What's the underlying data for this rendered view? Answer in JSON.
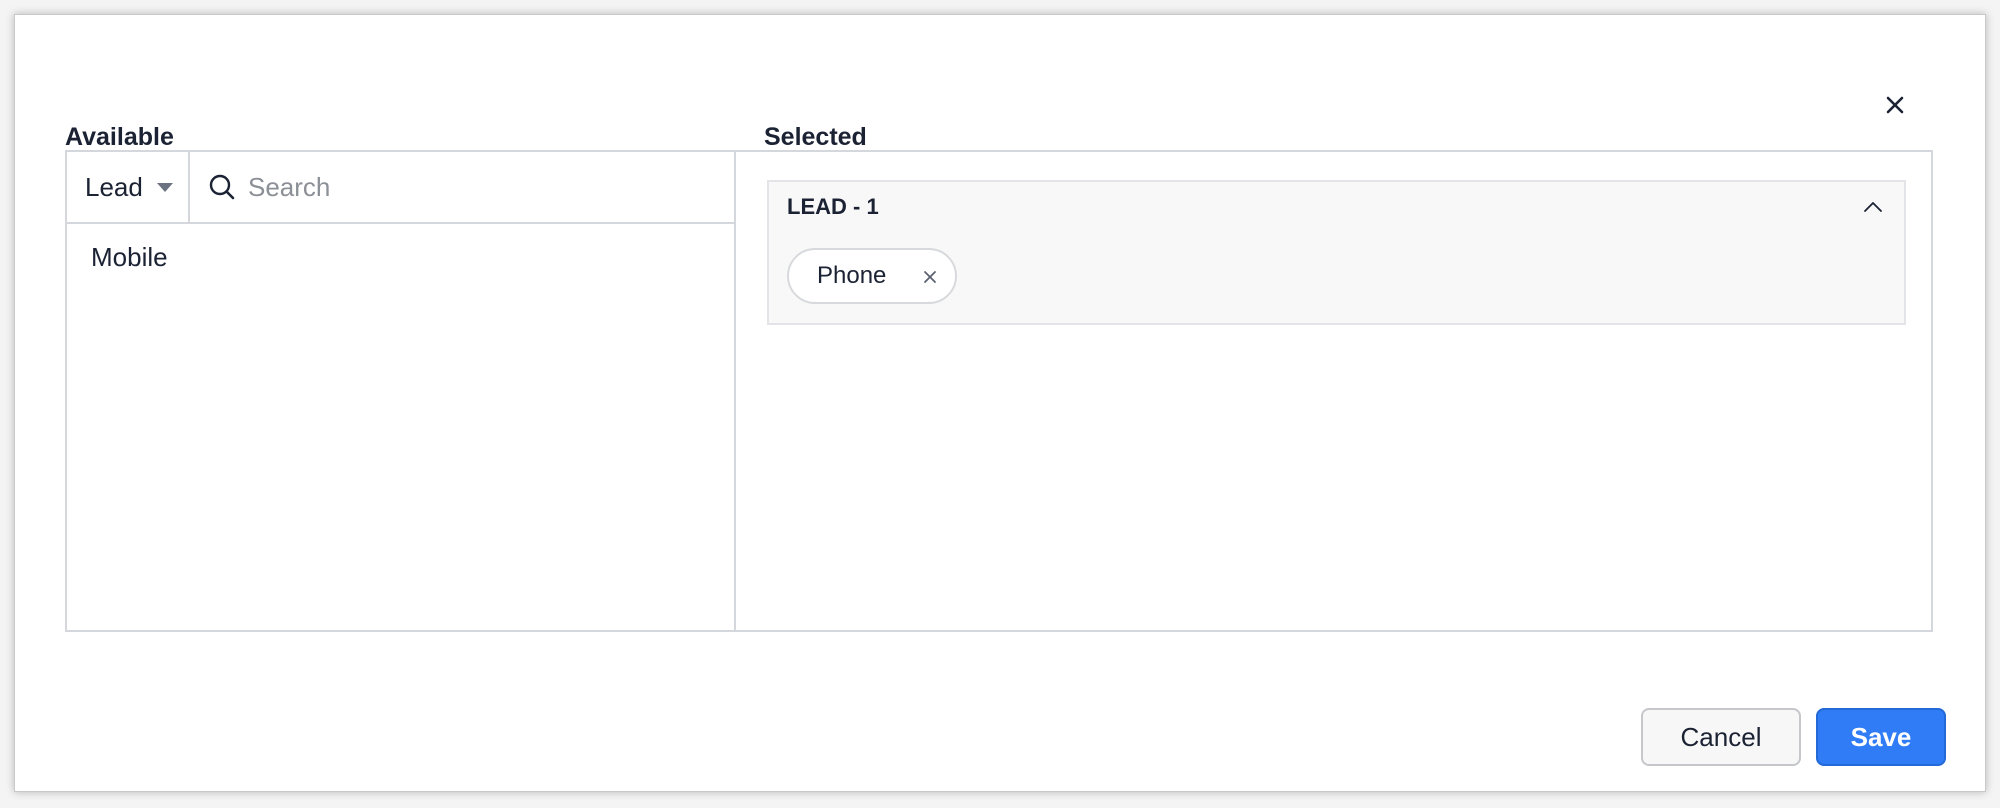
{
  "dialog": {
    "close_icon": "close-icon"
  },
  "available": {
    "title": "Available",
    "entity_select": "Lead",
    "search": {
      "placeholder": "Search",
      "value": "",
      "icon": "search-icon"
    },
    "items": [
      "Mobile"
    ]
  },
  "selected": {
    "title": "Selected",
    "groups": [
      {
        "label": "LEAD - 1",
        "collapse_icon": "chevron-up-icon",
        "fields": [
          {
            "label": "Phone",
            "remove_icon": "close-icon"
          }
        ]
      }
    ]
  },
  "footer": {
    "cancel_label": "Cancel",
    "save_label": "Save"
  },
  "colors": {
    "primary": "#2f7cf6",
    "text": "#1b2233",
    "border": "#d4d7dc"
  }
}
